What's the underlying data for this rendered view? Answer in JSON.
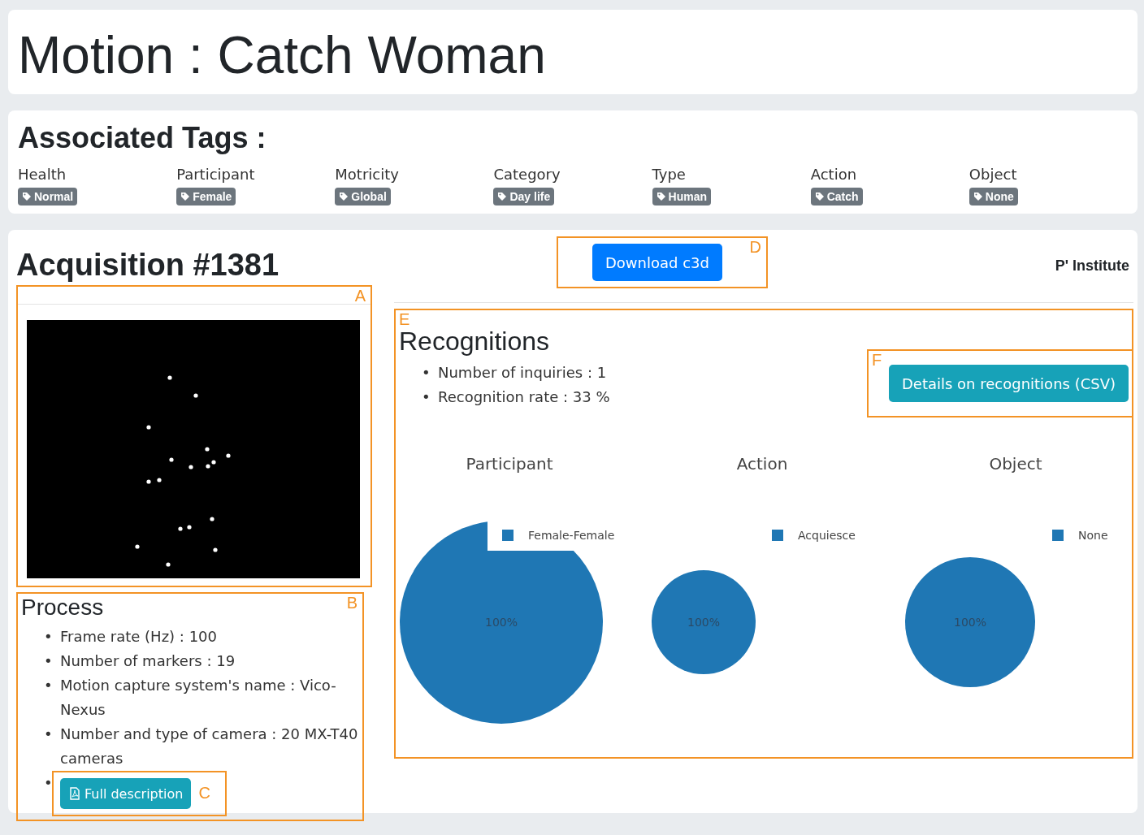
{
  "page": {
    "title": "Motion : Catch Woman"
  },
  "tags": {
    "heading": "Associated Tags :",
    "items": [
      {
        "label": "Health",
        "tag": "Normal"
      },
      {
        "label": "Participant",
        "tag": "Female"
      },
      {
        "label": "Motricity",
        "tag": "Global"
      },
      {
        "label": "Category",
        "tag": "Day life"
      },
      {
        "label": "Type",
        "tag": "Human"
      },
      {
        "label": "Action",
        "tag": "Catch"
      },
      {
        "label": "Object",
        "tag": "None"
      }
    ]
  },
  "acquisition": {
    "title": "Acquisition #1381",
    "download_button": "Download c3d",
    "institute": "P' Institute"
  },
  "process": {
    "heading": "Process",
    "bullet": "•",
    "items": [
      "Frame rate (Hz) : 100",
      "Number of markers : 19",
      "Motion capture system's name : Vico-Nexus",
      "Number and type of camera : 20 MX-T40 cameras"
    ],
    "button": "Full description"
  },
  "recognitions": {
    "heading": "Recognitions",
    "bullet": "•",
    "items": [
      "Number of inquiries : 1",
      "Recognition rate : 33 %"
    ],
    "button": "Details on recognitions (CSV)",
    "charts": [
      {
        "chart_data": {
          "type": "pie",
          "title": "Participant",
          "series": [
            {
              "name": "Female-Female",
              "color": "#1f77b4",
              "values": [
                100
              ]
            }
          ],
          "value_labels": [
            "100%"
          ]
        }
      },
      {
        "chart_data": {
          "type": "pie",
          "title": "Action",
          "series": [
            {
              "name": "Acquiesce",
              "color": "#1f77b4",
              "values": [
                100
              ]
            }
          ],
          "value_labels": [
            "100%"
          ]
        }
      },
      {
        "chart_data": {
          "type": "pie",
          "title": "Object",
          "series": [
            {
              "name": "None",
              "color": "#1f77b4",
              "values": [
                100
              ]
            }
          ],
          "value_labels": [
            "100%"
          ]
        }
      }
    ]
  },
  "annotations": {
    "preview": "A",
    "process": "B",
    "full_description": "C",
    "download": "D",
    "recognitions": "E",
    "details": "F"
  }
}
